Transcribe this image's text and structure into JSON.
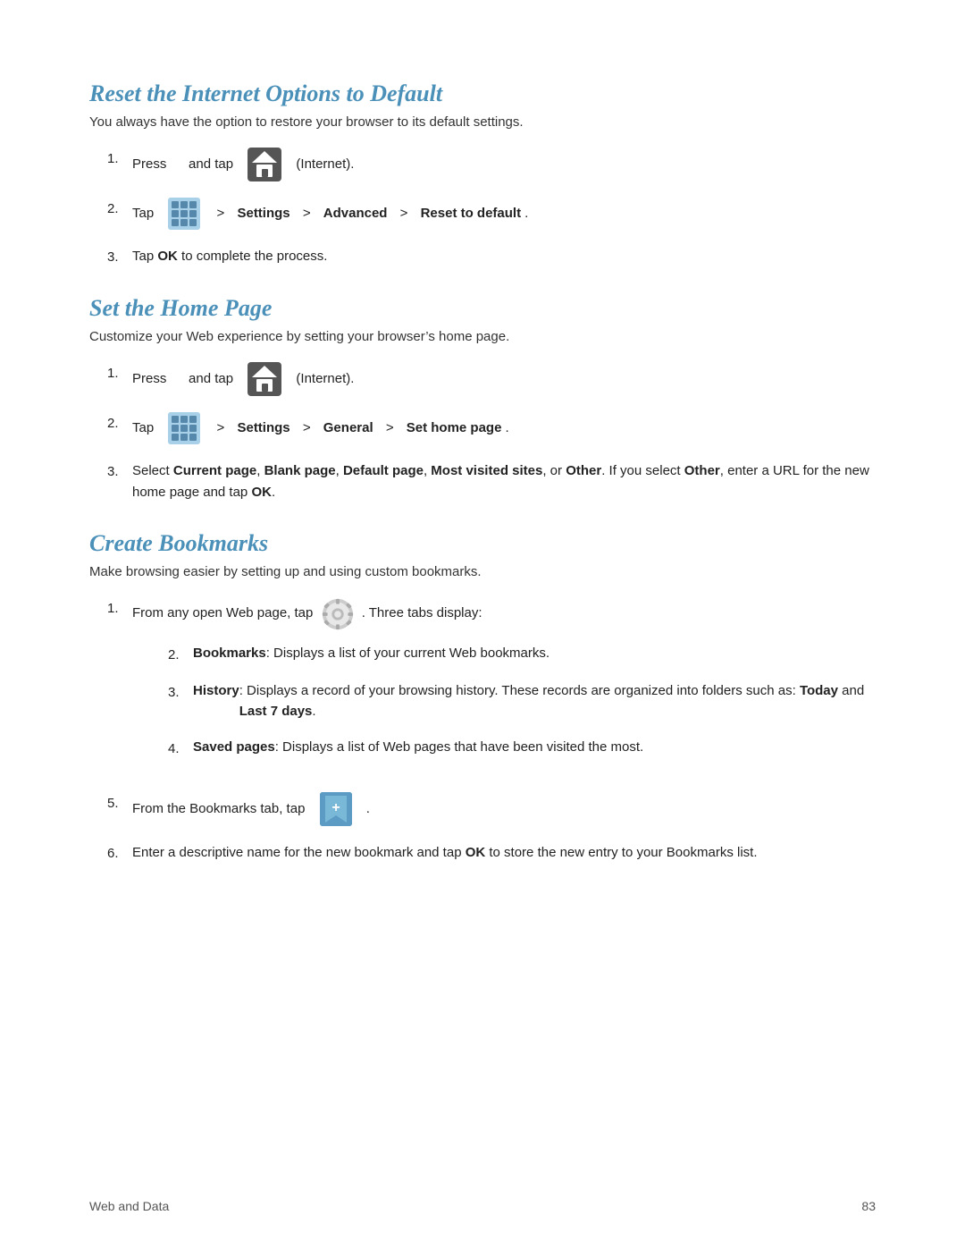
{
  "sections": [
    {
      "id": "reset-internet",
      "title": "Reset the Internet Options to Default",
      "subtitle": "You always have the option to restore your browser to its default settings.",
      "steps": [
        {
          "id": "s1-step1",
          "type": "press-and-tap",
          "prefix": "Press",
          "middle": "and tap",
          "icon1": "home",
          "icon2": null,
          "suffix": "(Internet)."
        },
        {
          "id": "s1-step2",
          "type": "tap-menu",
          "prefix": "Tap",
          "icon": "grid",
          "items": [
            {
              "text": "Settings",
              "bold": true
            },
            {
              "text": "Advanced",
              "bold": true
            },
            {
              "text": "Reset to default",
              "bold": true
            }
          ]
        },
        {
          "id": "s1-step3",
          "type": "text",
          "text": "Tap ",
          "boldPart": "OK",
          "suffix": " to complete the process."
        }
      ]
    },
    {
      "id": "set-home-page",
      "title": "Set the Home Page",
      "subtitle": "Customize your Web experience by setting your browser’s home page.",
      "steps": [
        {
          "id": "s2-step1",
          "type": "press-and-tap",
          "prefix": "Press",
          "middle": "and tap",
          "icon1": "home",
          "suffix": "(Internet)."
        },
        {
          "id": "s2-step2",
          "type": "tap-menu",
          "prefix": "Tap",
          "icon": "grid",
          "items": [
            {
              "text": "Settings",
              "bold": true
            },
            {
              "text": "General",
              "bold": true
            },
            {
              "text": "Set home page",
              "bold": true
            }
          ]
        },
        {
          "id": "s2-step3",
          "type": "complex",
          "text": "Select ",
          "parts": [
            {
              "text": "Current page",
              "bold": true
            },
            {
              "text": ", "
            },
            {
              "text": "Blank page",
              "bold": true
            },
            {
              "text": ", "
            },
            {
              "text": "Default page",
              "bold": true
            },
            {
              "text": ", "
            },
            {
              "text": "Most visited sites",
              "bold": true
            },
            {
              "text": ", or "
            },
            {
              "text": "Other",
              "bold": true
            },
            {
              "text": ". If you select "
            },
            {
              "text": "Other",
              "bold": true
            },
            {
              "text": ", enter a URL for the new home page and tap "
            },
            {
              "text": "OK",
              "bold": true
            },
            {
              "text": "."
            }
          ]
        }
      ]
    },
    {
      "id": "create-bookmarks",
      "title": "Create Bookmarks",
      "subtitle": "Make browsing easier by setting up and using custom bookmarks.",
      "steps": [
        {
          "id": "s3-step1",
          "type": "gear-with-sublist",
          "prefix": "From any open Web page, tap",
          "suffix": ". Three tabs display:",
          "subItems": [
            {
              "label": "Bookmarks",
              "text": ": Displays a list of your current Web bookmarks."
            },
            {
              "label": "History",
              "text": ": Displays a record of your browsing history. These records are organized into folders such as: ",
              "boldParts": [
                "Today",
                "Last 7 days"
              ],
              "trailingText": "."
            },
            {
              "label": "Saved pages",
              "text": ": Displays a list of Web pages that have been visited the most."
            }
          ]
        },
        {
          "id": "s3-step2",
          "type": "bookmark-tap",
          "prefix": "From the Bookmarks tab, tap",
          "suffix": "."
        },
        {
          "id": "s3-step3",
          "type": "text-complex",
          "text": "Enter a descriptive name for the new bookmark and tap ",
          "boldPart": "OK",
          "suffix": " to store the new entry to your Bookmarks list."
        }
      ]
    }
  ],
  "footer": {
    "left": "Web and Data",
    "right": "83"
  }
}
